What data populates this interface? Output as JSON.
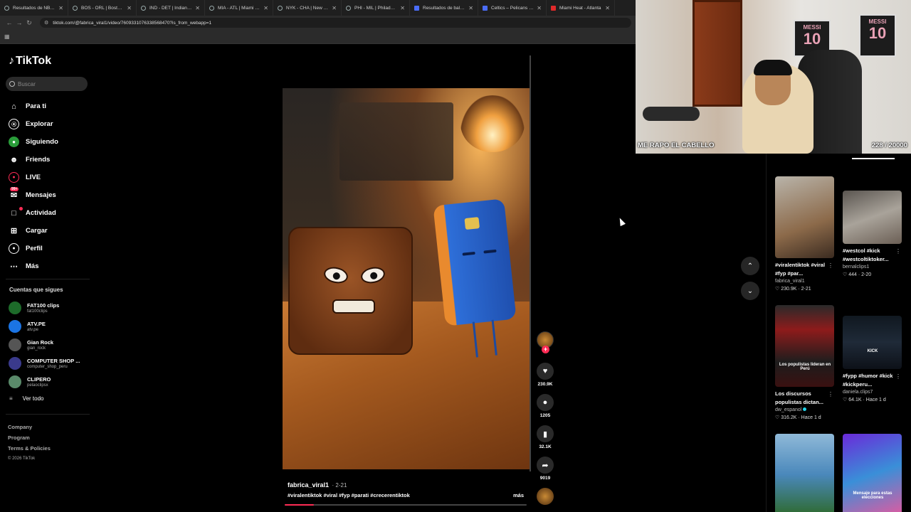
{
  "browser": {
    "tabs": [
      {
        "title": "Resultados de NBA 20",
        "icon": "generic"
      },
      {
        "title": "BOS - ORL | Boston Ce",
        "icon": "generic"
      },
      {
        "title": "IND - DET | Indiana Pa",
        "icon": "generic"
      },
      {
        "title": "MIA - ATL | Miami Hea",
        "icon": "generic"
      },
      {
        "title": "NYK - CHA | New York",
        "icon": "generic"
      },
      {
        "title": "PHI - MIL | Philadelphi",
        "icon": "generic"
      },
      {
        "title": "Resultados de balonc",
        "icon": "blue"
      },
      {
        "title": "Celtics – Pelicans man",
        "icon": "blue"
      },
      {
        "title": "Miami Heat - Atlanta",
        "icon": "red"
      }
    ],
    "url": "tiktok.com/@fabrica_viral1/video/7609331076338568470?is_from_webapp=1"
  },
  "sidebar": {
    "logo": "TikTok",
    "search_placeholder": "Buscar",
    "nav": [
      {
        "label": "Para ti",
        "icon": "home-icon"
      },
      {
        "label": "Explorar",
        "icon": "compass-icon"
      },
      {
        "label": "Siguiendo",
        "icon": "following-icon"
      },
      {
        "label": "Friends",
        "icon": "friends-icon"
      },
      {
        "label": "LIVE",
        "icon": "live-icon"
      },
      {
        "label": "Mensajes",
        "icon": "messages-icon",
        "badge": "99+"
      },
      {
        "label": "Actividad",
        "icon": "activity-icon"
      },
      {
        "label": "Cargar",
        "icon": "upload-icon"
      },
      {
        "label": "Perfil",
        "icon": "profile-icon"
      },
      {
        "label": "Más",
        "icon": "more-icon"
      }
    ],
    "following_title": "Cuentas que sigues",
    "following": [
      {
        "name": "FAT100 clips",
        "handle": "fat100clips",
        "color": "#1d6b2a"
      },
      {
        "name": "ATV.PE",
        "handle": "atv.pe",
        "color": "#1b74e4"
      },
      {
        "name": "Gian Rock",
        "handle": "gian_rock",
        "color": "#555555"
      },
      {
        "name": "COMPUTER SHOP ...",
        "handle": "computer_shop_peru",
        "color": "#3a3a8c"
      },
      {
        "name": "CLIPERO",
        "handle": "pelaoclipsx",
        "color": "#5a8a6a"
      }
    ],
    "see_all": "Ver todo",
    "footer": [
      "Company",
      "Program",
      "Terms & Policies"
    ],
    "copyright": "© 2026 TikTok"
  },
  "video": {
    "author": "fabrica_viral1",
    "date": "· 2-21",
    "hashtags": "#viralentiktok #viral  #fyp #parati #crecerentiktok",
    "more": "más",
    "progress": 0.12
  },
  "actions": {
    "likes": "230.9K",
    "comments": "1205",
    "saves": "32.1K",
    "shares": "9019"
  },
  "webcam": {
    "poster_name": "MESSI",
    "poster_number": "10",
    "label": "ME RAPO EL CABELLO",
    "counter": "228 / 20000"
  },
  "recommendations": [
    {
      "title": "#viralentiktok #viral #fyp #par...",
      "author": "fabrica_viral1",
      "likes": "230.9K",
      "date": "2-21",
      "verified": false,
      "thumb_label": ""
    },
    {
      "title": "#westcol #kick #westcoltiktoker...",
      "author": "bernalclips1",
      "likes": "444",
      "date": "2-20",
      "verified": false,
      "thumb_label": ""
    },
    {
      "title": "Los discursos populistas dictan...",
      "author": "dw_espanol",
      "likes": "316.2K",
      "date": "Hace 1 d",
      "verified": true,
      "thumb_label": "Los populistas lideran en Perú"
    },
    {
      "title": "#fypp #humor #kick #kickperu...",
      "author": "daniela.clips7",
      "likes": "64.1K",
      "date": "Hace 1 d",
      "verified": false,
      "thumb_label": "KICK"
    },
    {
      "title": "",
      "author": "",
      "likes": "",
      "date": "",
      "verified": false,
      "thumb_label": ""
    },
    {
      "title": "",
      "author": "",
      "likes": "",
      "date": "",
      "verified": false,
      "thumb_label": "Mensaje para estas elecciones"
    }
  ]
}
